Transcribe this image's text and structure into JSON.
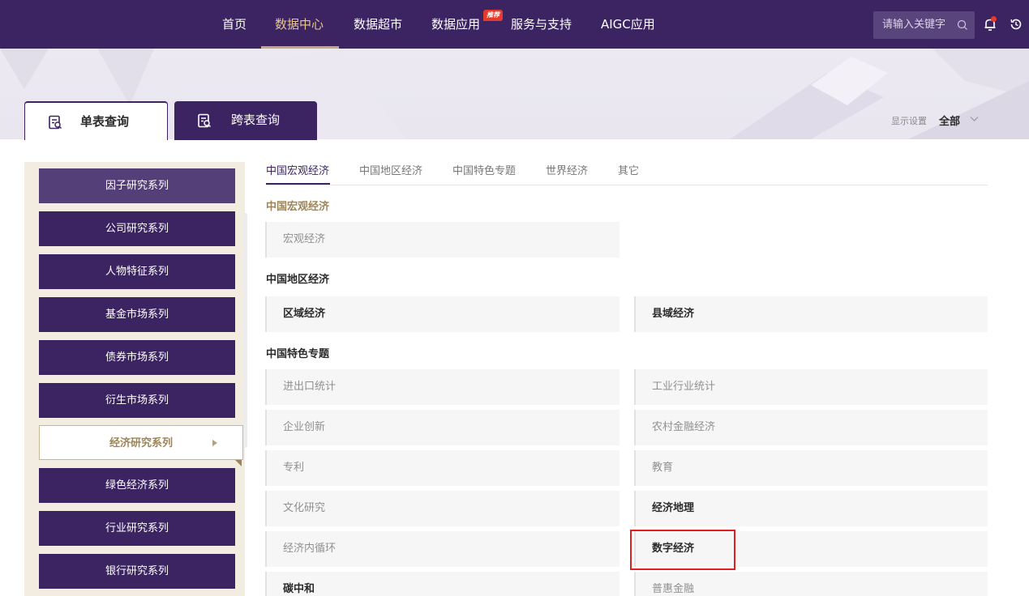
{
  "nav": {
    "items": [
      "首页",
      "数据中心",
      "数据超市",
      "数据应用",
      "服务与支持",
      "AIGC应用"
    ],
    "active_index": 1,
    "hot_badge": "推荐",
    "search_placeholder": "请输入关键字",
    "colors": {
      "bg": "#3c2463",
      "active": "#e8c88a",
      "badge": "#e23b2e"
    },
    "icons": [
      "search-icon",
      "bell-icon",
      "history-icon"
    ]
  },
  "query_tabs": {
    "single": "单表查询",
    "cross": "跨表查询",
    "display_setting_label": "显示设置",
    "display_setting_value": "全部"
  },
  "sidebar": {
    "items": [
      "因子研究系列",
      "公司研究系列",
      "人物特征系列",
      "基金市场系列",
      "债券市场系列",
      "衍生市场系列",
      "经济研究系列",
      "绿色经济系列",
      "行业研究系列",
      "银行研究系列"
    ],
    "active_index": 6
  },
  "content": {
    "tabs": [
      "中国宏观经济",
      "中国地区经济",
      "中国特色专题",
      "世界经济",
      "其它"
    ],
    "active_tab": 0,
    "sections": [
      {
        "title": "中国宏观经济",
        "items": [
          "宏观经济"
        ]
      },
      {
        "title": "中国地区经济",
        "items": [
          "区域经济",
          "县域经济"
        ]
      },
      {
        "title": "中国特色专题",
        "items": [
          "进出口统计",
          "工业行业统计",
          "企业创新",
          "农村金融经济",
          "专利",
          "教育",
          "文化研究",
          "经济地理",
          "经济内循环",
          "数字经济",
          "碳中和",
          "普惠金融"
        ]
      }
    ],
    "highlighted_item": "数字经济"
  }
}
